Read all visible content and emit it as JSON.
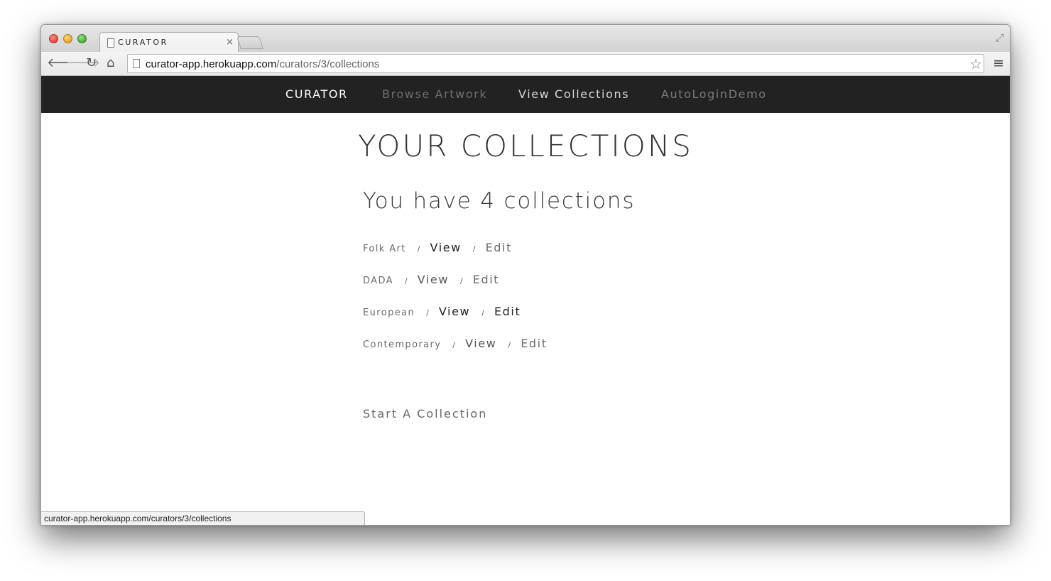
{
  "browser": {
    "tab_title": "CURATOR",
    "tab_close": "×",
    "url_host": "curator-app.herokuapp.com",
    "url_path": "/curators/3/collections",
    "status_url": "curator-app.herokuapp.com/curators/3/collections"
  },
  "nav": {
    "brand": "CURATOR",
    "browse": "Browse Artwork",
    "view": "View Collections",
    "autologin": "AutoLoginDemo"
  },
  "page": {
    "title": "YOUR COLLECTIONS",
    "count_heading": "You have 4 collections",
    "start_link": "Start A Collection"
  },
  "collections": [
    {
      "name": "Folk Art",
      "view": "View",
      "edit": "Edit"
    },
    {
      "name": "DADA",
      "view": "View",
      "edit": "Edit"
    },
    {
      "name": "European",
      "view": "View",
      "edit": "Edit"
    },
    {
      "name": "Contemporary",
      "view": "View",
      "edit": "Edit"
    }
  ],
  "separator": "/"
}
